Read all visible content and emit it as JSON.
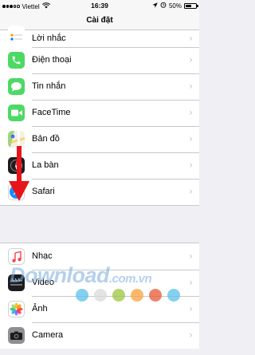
{
  "status_bar": {
    "carrier": "Viettel",
    "time": "16:39",
    "battery_percent_label": "50%",
    "battery_level": 0.5
  },
  "nav": {
    "title": "Cài đặt"
  },
  "group1": [
    {
      "label": "Lời nhắc",
      "icon": "reminders-icon",
      "color": "#ffffff"
    },
    {
      "label": "Điện thoại",
      "icon": "phone-icon",
      "color": "#4cd964"
    },
    {
      "label": "Tin nhắn",
      "icon": "messages-icon",
      "color": "#4cd964"
    },
    {
      "label": "FaceTime",
      "icon": "facetime-icon",
      "color": "#4cd964"
    },
    {
      "label": "Bản đồ",
      "icon": "maps-icon",
      "color": "#ffffff"
    },
    {
      "label": "La bàn",
      "icon": "compass-icon",
      "color": "#1c1c1e"
    },
    {
      "label": "Safari",
      "icon": "safari-icon",
      "color": "#ffffff"
    }
  ],
  "group2": [
    {
      "label": "Nhạc",
      "icon": "music-icon",
      "color": "#ffffff"
    },
    {
      "label": "Video",
      "icon": "video-icon",
      "color": "#1c1c1e"
    },
    {
      "label": "Ảnh",
      "icon": "photos-icon",
      "color": "#ffffff"
    },
    {
      "label": "Camera",
      "icon": "camera-icon",
      "color": "#8e8e93"
    }
  ],
  "watermark": {
    "text": "Download",
    "suffix": ".com.vn",
    "dot_colors": [
      "#5bc0eb",
      "#d9d9d9",
      "#9bc53d",
      "#f9a03f",
      "#e55934",
      "#5bc0eb"
    ]
  },
  "annotation_color": "#e8141b"
}
